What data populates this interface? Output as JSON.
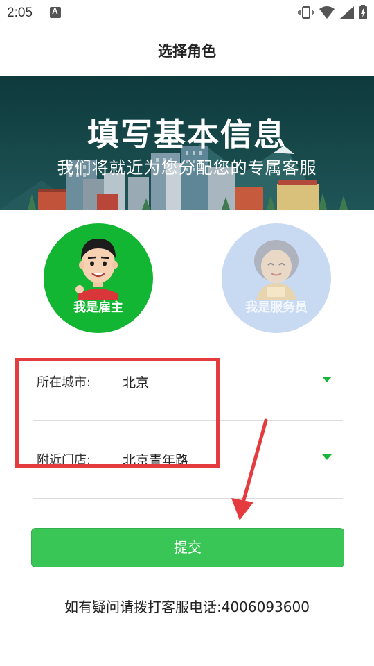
{
  "status_bar": {
    "time": "2:05",
    "notification_icon": "a-notification-icon",
    "icons": [
      "vibrate-icon",
      "wifi-icon",
      "signal-icon",
      "battery-charging-icon"
    ]
  },
  "header": {
    "title": "选择角色"
  },
  "banner": {
    "title": "填写基本信息",
    "subtitle": "我们将就近为您分配您的专属客服"
  },
  "roles": {
    "employer": {
      "label": "我是雇主",
      "color": "#13b632",
      "selected": true
    },
    "helper": {
      "label": "我是服务员",
      "color": "#c8d9f2",
      "selected": false
    }
  },
  "form": {
    "city": {
      "label": "所在城市:",
      "value": "北京"
    },
    "store": {
      "label": "附近门店:",
      "value": "北京青年路"
    },
    "accent": "#1ab43a"
  },
  "submit": {
    "label": "提交",
    "color": "#3ac657"
  },
  "footer": {
    "hotline": "如有疑问请拨打客服电话:4006093600"
  },
  "annotation": {
    "color": "#e33b3e"
  }
}
